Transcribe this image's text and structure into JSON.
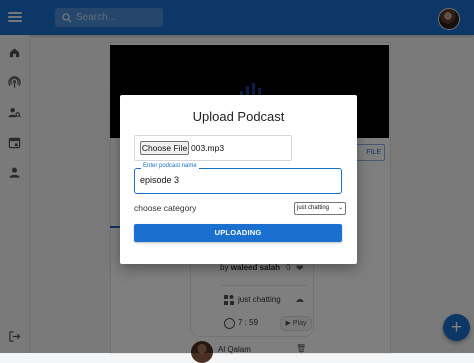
{
  "header": {
    "search_placeholder": "Search…"
  },
  "sidebar": {
    "icons": [
      "home-icon",
      "podcast-icon",
      "user-search-icon",
      "calendar-icon",
      "person-icon",
      "logout-icon"
    ]
  },
  "background": {
    "profile_button_label": "FILE",
    "episode": {
      "by_prefix": "by",
      "author": "waleed salah",
      "likes": "0",
      "category": "just chatting",
      "duration": "7 : 59",
      "play_label": "Play"
    },
    "comment_author": "Al Qalam"
  },
  "dialog": {
    "title": "Upload Podcast",
    "file_button_label": "Choose File",
    "file_name": "003.mp3",
    "name_field_label": "Enter podcast name",
    "name_field_value": "episode 3",
    "category_label": "choose category",
    "category_selected": "just chatting",
    "upload_button_label": "UPLOADING"
  },
  "colors": {
    "primary": "#1b6fce"
  }
}
